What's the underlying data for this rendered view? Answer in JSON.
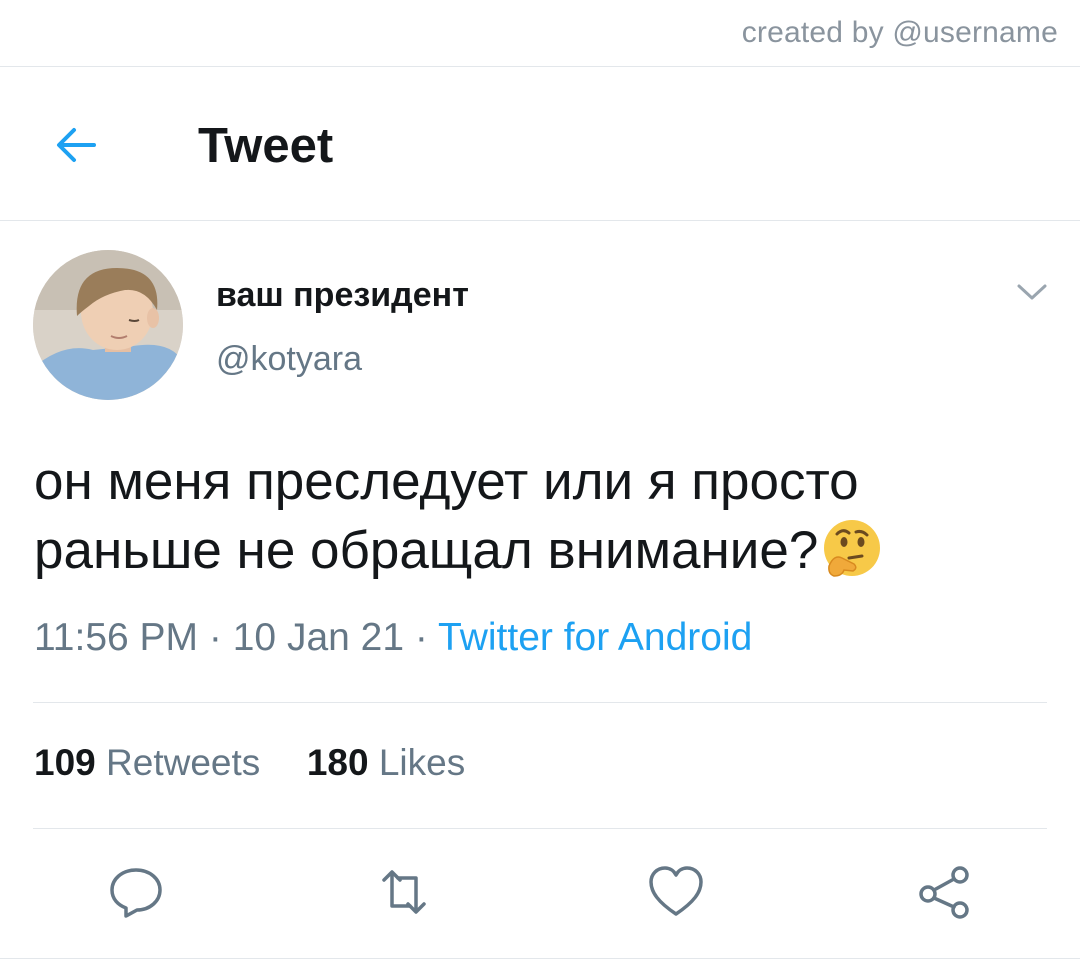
{
  "credit": "created by @username",
  "header": {
    "title": "Tweet",
    "back_icon": "arrow-left-icon"
  },
  "tweet": {
    "author": {
      "display_name": "ваш президент",
      "handle": "@kotyara"
    },
    "text": "он меня преследует или я просто раньше не обращал внимание?",
    "emoji": "thinking-face",
    "time": "11:56 PM",
    "date": "10 Jan 21",
    "source": "Twitter for Android",
    "separator": "·"
  },
  "stats": {
    "retweets_count": "109",
    "retweets_label": "Retweets",
    "likes_count": "180",
    "likes_label": "Likes"
  },
  "actions": [
    "reply-icon",
    "retweet-icon",
    "like-icon",
    "share-icon"
  ],
  "colors": {
    "accent": "#1da1f2",
    "text": "#14171a",
    "secondary": "#657786",
    "divider": "#e3e7eb",
    "emoji": "#f7c948"
  }
}
